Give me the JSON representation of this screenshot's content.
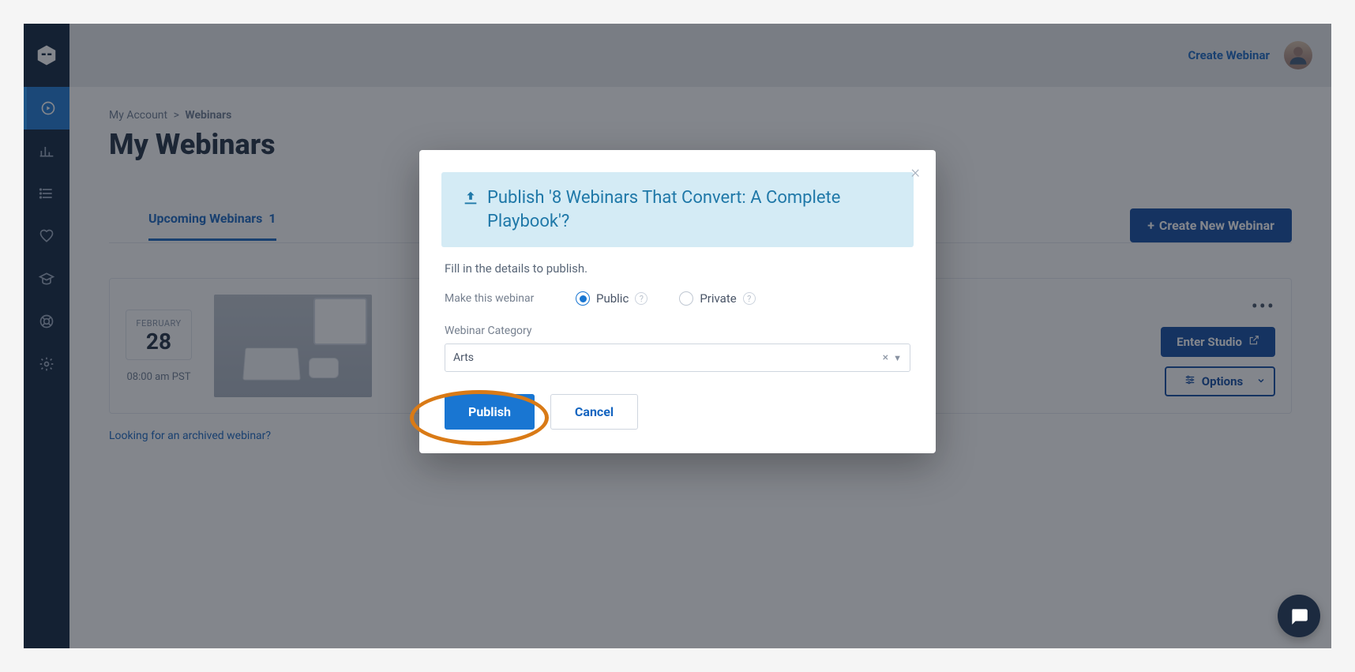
{
  "header": {
    "create_link": "Create Webinar"
  },
  "breadcrumb": {
    "parent": "My Account",
    "sep": ">",
    "current": "Webinars"
  },
  "page_title": "My Webinars",
  "tabs": {
    "upcoming_label": "Upcoming Webinars",
    "upcoming_count": "1"
  },
  "buttons": {
    "create_new": "Create New Webinar",
    "enter_studio": "Enter Studio",
    "options": "Options"
  },
  "card": {
    "month": "FEBRUARY",
    "day": "28",
    "time": "08:00 am PST"
  },
  "archived_link": "Looking for an archived webinar?",
  "modal": {
    "title_prefix": "Publish '8 Webinars That Convert: A Complete Playbook'?",
    "subtitle": "Fill in the details to publish.",
    "visibility_label": "Make this webinar",
    "radio_public": "Public",
    "radio_private": "Private",
    "category_label": "Webinar Category",
    "category_value": "Arts",
    "publish": "Publish",
    "cancel": "Cancel"
  }
}
